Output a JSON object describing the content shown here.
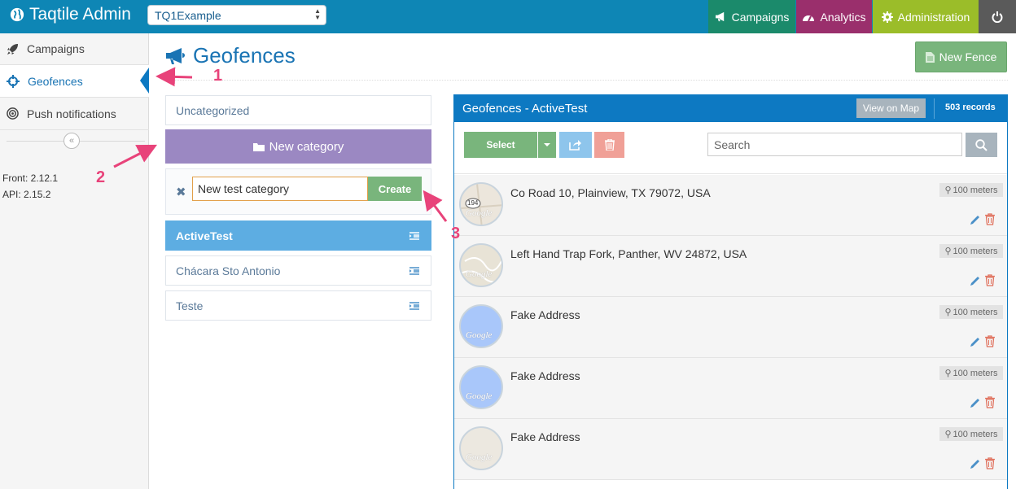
{
  "app": {
    "title": "Taqtile Admin",
    "environment": "TQ1Example"
  },
  "topnav": {
    "campaigns": "Campaigns",
    "analytics": "Analytics",
    "administration": "Administration"
  },
  "sidebar": {
    "items": [
      {
        "label": "Campaigns",
        "icon": "rocket-icon"
      },
      {
        "label": "Geofences",
        "icon": "crosshair-icon",
        "active": true
      },
      {
        "label": "Push notifications",
        "icon": "target-icon"
      }
    ],
    "front_version": "Front: 2.12.1",
    "api_version": "API: 2.15.2"
  },
  "page": {
    "title": "Geofences",
    "new_fence_label": "New Fence"
  },
  "categories": {
    "uncategorized": "Uncategorized",
    "new_category_label": "New category",
    "input_value": "New test category",
    "create_label": "Create",
    "list": [
      "ActiveTest",
      "Chácara Sto Antonio",
      "Teste"
    ],
    "active": "ActiveTest"
  },
  "panel": {
    "title": "Geofences - ActiveTest",
    "view_map_label": "View on Map",
    "record_count": "503 records",
    "select_label": "Select",
    "search_placeholder": "Search",
    "rows": [
      {
        "address": "Co Road 10, Plainview, TX 79072, USA",
        "radius": "100 meters",
        "thumb_color": "#ece6dc",
        "road_label": "194"
      },
      {
        "address": "Left Hand Trap Fork, Panther, WV 24872, USA",
        "radius": "100 meters",
        "thumb_color": "#e8e3d6"
      },
      {
        "address": "Fake Address",
        "radius": "100 meters",
        "thumb_color": "#a9c7fa"
      },
      {
        "address": "Fake Address",
        "radius": "100 meters",
        "thumb_color": "#a9c7fa"
      },
      {
        "address": "Fake Address",
        "radius": "100 meters",
        "thumb_color": "#ece8e0"
      }
    ],
    "map_watermark": "Google"
  },
  "annotations": [
    "1",
    "2",
    "3"
  ],
  "colors": {
    "topbar": "#0e86b5",
    "campaigns": "#1b8a6b",
    "analytics": "#9a2f6c",
    "administration": "#9bbd29",
    "accent": "#0d79c2",
    "new_category": "#9b88c2",
    "success": "#79b57c",
    "danger": "#f0a097",
    "annotation": "#e8437a"
  }
}
